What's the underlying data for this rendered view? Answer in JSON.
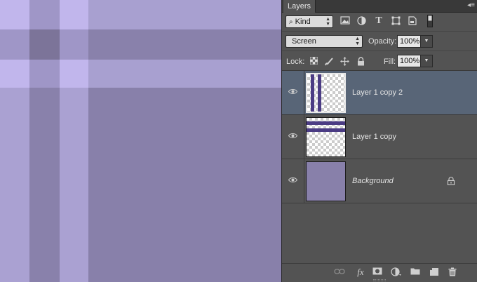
{
  "canvas": {
    "background": "#8880aa",
    "band_light": "#b0a6da",
    "band_dark": "#7a7299",
    "band_cross": "#c2b7ef"
  },
  "panel": {
    "tab_label": "Layers",
    "menu_icon": "panel-menu-icon"
  },
  "filter": {
    "kind_label": "Kind",
    "icons": [
      "pixel-filter-icon",
      "adjustment-filter-icon",
      "type-filter-icon",
      "shape-filter-icon",
      "smart-object-filter-icon",
      "filter-toggle-icon"
    ]
  },
  "blend": {
    "mode": "Screen",
    "opacity_label": "Opacity:",
    "opacity_value": "100%"
  },
  "lock": {
    "label": "Lock:",
    "icons": [
      "lock-transparent-icon",
      "lock-image-icon",
      "lock-position-icon",
      "lock-all-icon"
    ],
    "fill_label": "Fill:",
    "fill_value": "100%"
  },
  "layers": [
    {
      "name": "Layer 1 copy 2",
      "selected": true,
      "visible": true,
      "thumb": "vertical-bars"
    },
    {
      "name": "Layer 1 copy",
      "selected": false,
      "visible": true,
      "thumb": "horizontal-bars"
    },
    {
      "name": "Background",
      "selected": false,
      "visible": true,
      "thumb": "solid",
      "locked": true
    }
  ],
  "bottom_icons": [
    "link-layers-icon",
    "fx-icon",
    "add-mask-icon",
    "adjustment-layer-icon",
    "new-group-icon",
    "new-layer-icon",
    "delete-layer-icon"
  ],
  "fx_label": "fx"
}
